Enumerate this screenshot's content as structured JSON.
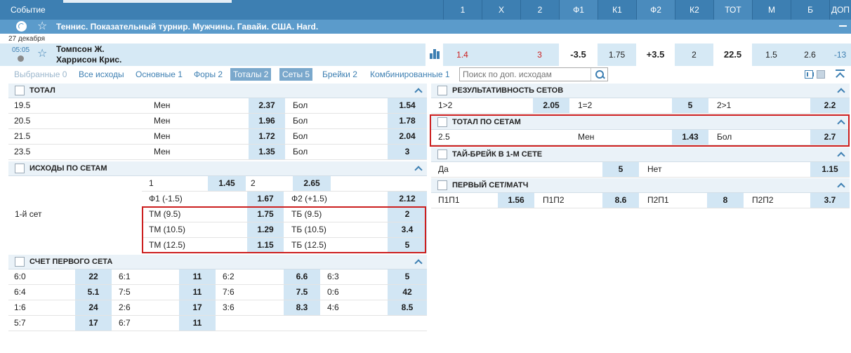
{
  "header": {
    "event_label": "Событие",
    "columns": [
      "1",
      "X",
      "2",
      "Ф1",
      "К1",
      "Ф2",
      "К2",
      "ТОТ",
      "М",
      "Б",
      "ДОП"
    ]
  },
  "league": {
    "name": "Теннис. Показательный турнир. Мужчины. Гавайи. США. Hard."
  },
  "event": {
    "date": "27 декабря",
    "time": "05:05",
    "team1": "Томпсон Ж.",
    "team2": "Харрисон Крис.",
    "odds": [
      "1.4",
      "",
      "3",
      "-3.5",
      "1.75",
      "+3.5",
      "2",
      "22.5",
      "1.5",
      "2.6",
      "-13"
    ]
  },
  "tabs": [
    {
      "label": "Выбранные 0"
    },
    {
      "label": "Все исходы"
    },
    {
      "label": "Основные 1"
    },
    {
      "label": "Форы 2"
    },
    {
      "label": "Тоталы 2"
    },
    {
      "label": "Сеты 5"
    },
    {
      "label": "Брейки 2"
    },
    {
      "label": "Комбинированные 1"
    }
  ],
  "search": {
    "placeholder": "Поиск по доп. исходам"
  },
  "total": {
    "title": "ТОТАЛ",
    "rows": [
      {
        "line": "19.5",
        "under_label": "Мен",
        "under": "2.37",
        "over_label": "Бол",
        "over": "1.54"
      },
      {
        "line": "20.5",
        "under_label": "Мен",
        "under": "1.96",
        "over_label": "Бол",
        "over": "1.78"
      },
      {
        "line": "21.5",
        "under_label": "Мен",
        "under": "1.72",
        "over_label": "Бол",
        "over": "2.04"
      },
      {
        "line": "23.5",
        "under_label": "Мен",
        "under": "1.35",
        "over_label": "Бол",
        "over": "3"
      }
    ]
  },
  "set_outcomes": {
    "title": "ИСХОДЫ ПО СЕТАМ",
    "set_label": "1-й сет",
    "rows": [
      {
        "l1": "1",
        "o1": "1.45",
        "l2": "2",
        "o2": "2.65"
      },
      {
        "l1": "Ф1 (-1.5)",
        "o1": "1.67",
        "l2": "Ф2 (+1.5)",
        "o2": "2.12"
      },
      {
        "l1": "ТМ (9.5)",
        "o1": "1.75",
        "l2": "ТБ (9.5)",
        "o2": "2"
      },
      {
        "l1": "ТМ (10.5)",
        "o1": "1.29",
        "l2": "ТБ (10.5)",
        "o2": "3.4"
      },
      {
        "l1": "ТМ (12.5)",
        "o1": "1.15",
        "l2": "ТБ (12.5)",
        "o2": "5"
      }
    ]
  },
  "first_set_score": {
    "title": "СЧЕТ ПЕРВОГО СЕТА",
    "rows": [
      [
        {
          "s": "6:0",
          "o": "22"
        },
        {
          "s": "6:1",
          "o": "11"
        },
        {
          "s": "6:2",
          "o": "6.6"
        },
        {
          "s": "6:3",
          "o": "5"
        }
      ],
      [
        {
          "s": "6:4",
          "o": "5.1"
        },
        {
          "s": "7:5",
          "o": "11"
        },
        {
          "s": "7:6",
          "o": "7.5"
        },
        {
          "s": "0:6",
          "o": "42"
        }
      ],
      [
        {
          "s": "1:6",
          "o": "24"
        },
        {
          "s": "2:6",
          "o": "17"
        },
        {
          "s": "3:6",
          "o": "8.3"
        },
        {
          "s": "4:6",
          "o": "8.5"
        }
      ],
      [
        {
          "s": "5:7",
          "o": "17"
        },
        {
          "s": "6:7",
          "o": "11"
        }
      ]
    ]
  },
  "sets_productivity": {
    "title": "РЕЗУЛЬТАТИВНОСТЬ СЕТОВ",
    "cells": [
      {
        "label": "1>2",
        "odd": "2.05"
      },
      {
        "label": "1=2",
        "odd": "5"
      },
      {
        "label": "2>1",
        "odd": "2.2"
      }
    ]
  },
  "total_by_sets": {
    "title": "ТОТАЛ ПО СЕТАМ",
    "line": "2.5",
    "under_label": "Мен",
    "under": "1.43",
    "over_label": "Бол",
    "over": "2.7"
  },
  "tiebreak_first_set": {
    "title": "ТАЙ-БРЕЙК В 1-М СЕТЕ",
    "yes_label": "Да",
    "yes": "5",
    "no_label": "Нет",
    "no": "1.15"
  },
  "first_set_match": {
    "title": "ПЕРВЫЙ СЕТ/МАТЧ",
    "cells": [
      {
        "label": "П1П1",
        "odd": "1.56"
      },
      {
        "label": "П1П2",
        "odd": "8.6"
      },
      {
        "label": "П2П1",
        "odd": "8"
      },
      {
        "label": "П2П2",
        "odd": "3.7"
      }
    ]
  },
  "colors": {
    "header_bg": "#3d7fb2",
    "league_bg": "#5b9bcb",
    "odd_cell_bg": "#d2e6f4",
    "block_head_bg": "#eaf2f8",
    "highlight_border": "#cc1f1f",
    "negative_odd": "#cc2222"
  }
}
